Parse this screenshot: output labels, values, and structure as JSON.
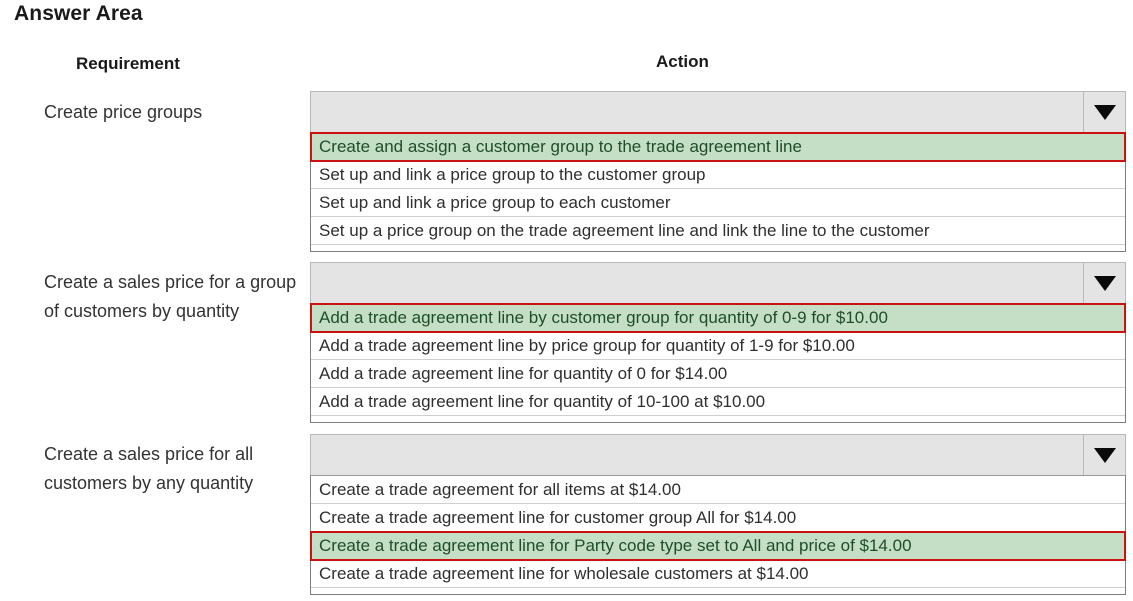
{
  "page": {
    "title": "Answer Area"
  },
  "columns": {
    "requirement_header": "Requirement",
    "action_header": "Action"
  },
  "colors": {
    "selected_background": "#c5dfc6",
    "selected_text": "#1f4d28",
    "selection_outline": "#cc1111",
    "combo_background": "#e4e4e4",
    "list_border": "#7d7d7d"
  },
  "icons": {
    "dropdown_caret": "chevron-down-icon"
  },
  "rows": [
    {
      "requirement": "Create price groups",
      "combo_value": "",
      "options": [
        {
          "label": "Create and assign a customer group to the trade agreement line",
          "selected": true
        },
        {
          "label": "Set up and link a price group to the customer group",
          "selected": false
        },
        {
          "label": "Set up and link a price group to each customer",
          "selected": false
        },
        {
          "label": "Set up a price group on the trade agreement line and link the line to the customer",
          "selected": false
        }
      ]
    },
    {
      "requirement": "Create a sales price for a group of customers by quantity",
      "combo_value": "",
      "options": [
        {
          "label": "Add a trade agreement line by customer group for quantity of 0-9 for $10.00",
          "selected": true
        },
        {
          "label": "Add a trade agreement line by price group for quantity of 1-9 for $10.00",
          "selected": false
        },
        {
          "label": "Add a trade agreement line for quantity of 0 for $14.00",
          "selected": false
        },
        {
          "label": "Add a trade agreement line for quantity of 10-100 at $10.00",
          "selected": false
        }
      ]
    },
    {
      "requirement": "Create a sales price for all customers by any quantity",
      "combo_value": "",
      "options": [
        {
          "label": "Create a trade agreement for all items at $14.00",
          "selected": false
        },
        {
          "label": "Create a trade agreement line for customer group All for $14.00",
          "selected": false
        },
        {
          "label": "Create a trade agreement line for Party code type set to All and price of $14.00",
          "selected": true
        },
        {
          "label": "Create a trade agreement line for wholesale customers at $14.00",
          "selected": false
        }
      ]
    }
  ]
}
